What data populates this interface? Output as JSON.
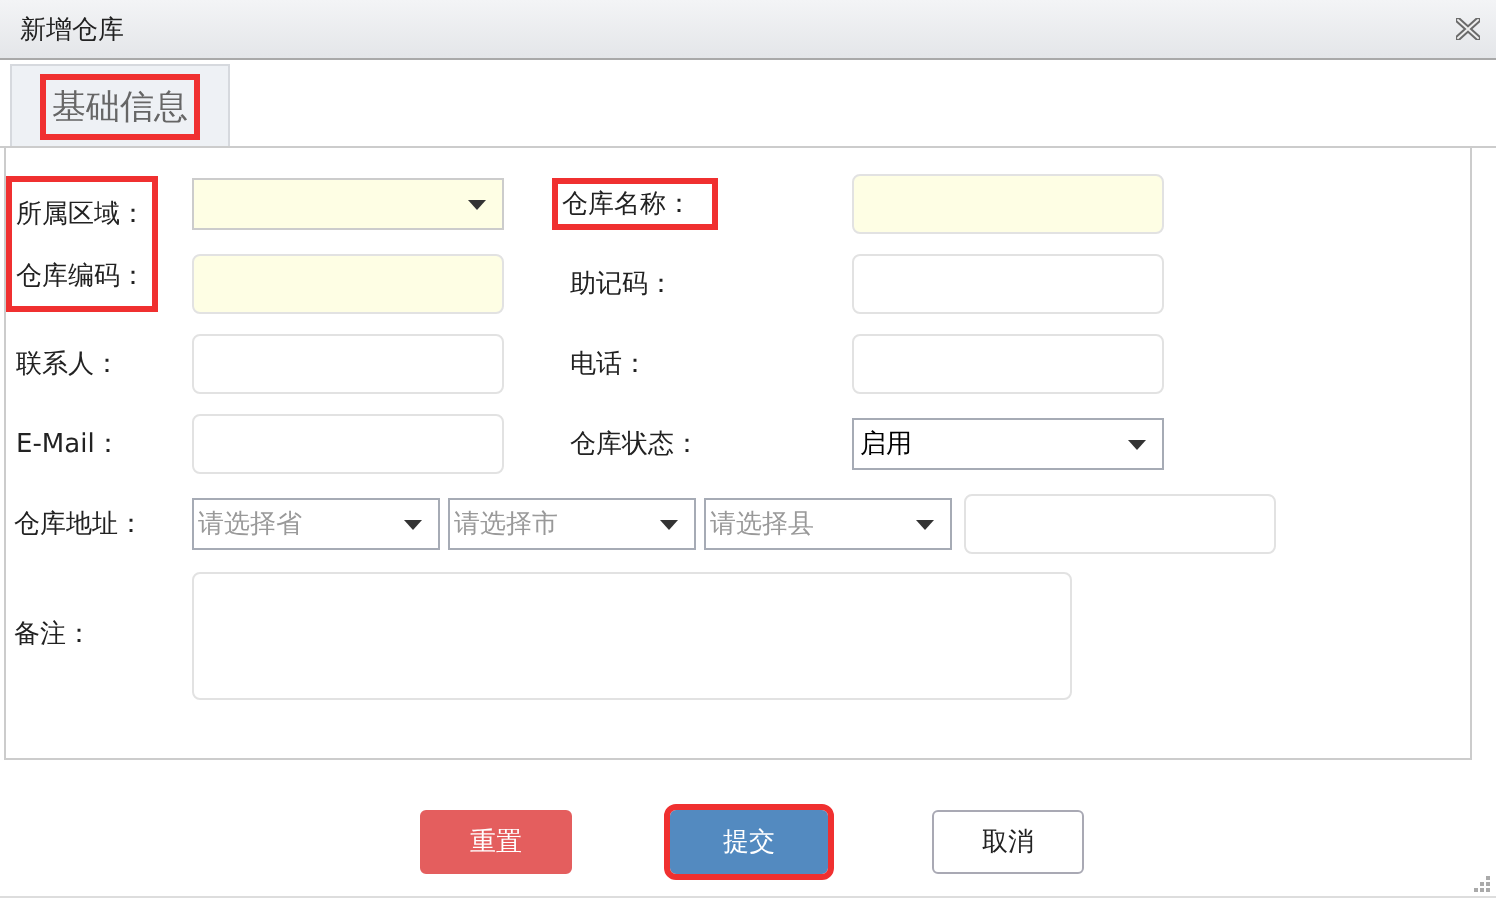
{
  "window": {
    "title": "新增仓库"
  },
  "tabs": [
    {
      "label": "基础信息",
      "selected": true,
      "highlighted": true
    }
  ],
  "fields": [
    {
      "label": "所属区域：",
      "kind": "select",
      "required": true,
      "highlighted": true
    },
    {
      "label": "仓库名称：",
      "kind": "input",
      "required": true,
      "highlighted": true
    },
    {
      "label": "仓库编码：",
      "kind": "input",
      "required": true,
      "highlighted": true
    },
    {
      "label": "助记码：",
      "kind": "input",
      "required": false,
      "highlighted": false
    },
    {
      "label": "联系人：",
      "kind": "input",
      "required": false,
      "highlighted": false
    },
    {
      "label": "电话：",
      "kind": "input",
      "required": false,
      "highlighted": false
    },
    {
      "label": "E-Mail：",
      "kind": "input",
      "required": false,
      "highlighted": false
    },
    {
      "label": "仓库状态：",
      "kind": "select",
      "value": "启用",
      "required": false,
      "highlighted": false
    }
  ],
  "address": {
    "label": "仓库地址：",
    "selects": [
      {
        "placeholder": "请选择省"
      },
      {
        "placeholder": "请选择市"
      },
      {
        "placeholder": "请选择县"
      }
    ]
  },
  "remark": {
    "label": "备注："
  },
  "buttons": [
    {
      "label": "重置",
      "kind": "danger",
      "highlighted": false
    },
    {
      "label": "提交",
      "kind": "primary",
      "highlighted": true
    },
    {
      "label": "取消",
      "kind": "default",
      "highlighted": false
    }
  ]
}
